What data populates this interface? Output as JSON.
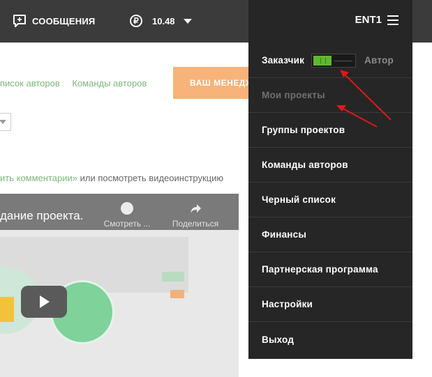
{
  "header": {
    "messages_label": "СООБЩЕНИЯ",
    "balance_currency_symbol": "₽",
    "balance_value": "10.48"
  },
  "content": {
    "links": [
      "писок авторов",
      "Команды авторов"
    ],
    "manager_button": "ВАШ МЕНЕДЖ",
    "comment_link": "ить комментарии»",
    "comment_rest": " или посмотреть видеоинструкцию",
    "video": {
      "title": "дание проекта.",
      "watch_label": "Смотреть ...",
      "share_label": "Поделиться"
    }
  },
  "menu": {
    "account": "ENT1",
    "role_left": "Заказчик",
    "role_right": "Автор",
    "items": [
      {
        "label": "Мои проекты",
        "disabled": true
      },
      {
        "label": "Группы проектов",
        "disabled": false
      },
      {
        "label": "Команды авторов",
        "disabled": false
      },
      {
        "label": "Черный список",
        "disabled": false
      },
      {
        "label": "Финансы",
        "disabled": false
      },
      {
        "label": "Партнерская программа",
        "disabled": false
      },
      {
        "label": "Настройки",
        "disabled": false
      },
      {
        "label": "Выход",
        "disabled": false
      }
    ]
  },
  "colors": {
    "header_bg": "#3b3b3b",
    "menu_bg": "#262626",
    "accent_green": "#5fb830",
    "link_green": "#7cb87a",
    "manager_orange": "#f7b37a",
    "annotation_red": "#e01818"
  }
}
